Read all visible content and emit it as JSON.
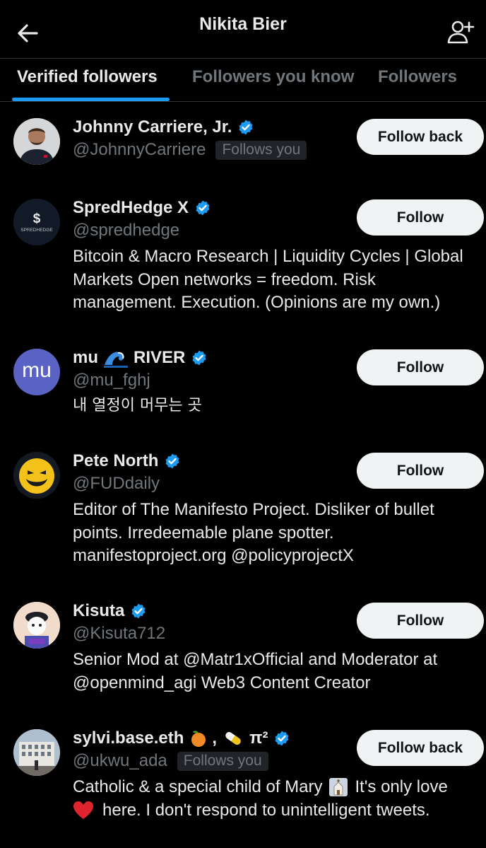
{
  "header": {
    "title": "Nikita Bier"
  },
  "tabs": [
    {
      "label": "Verified followers"
    },
    {
      "label": "Followers you know"
    },
    {
      "label": "Followers"
    }
  ],
  "colors": {
    "accent": "#1d9bf0",
    "verified": "#1d9bf0",
    "button_bg": "#eff3f4"
  },
  "users": [
    {
      "name": "Johnny Carriere, Jr.",
      "handle": "@JohnnyCarriere",
      "follows_you": "Follows you",
      "button": "Follow back",
      "bio": []
    },
    {
      "name": "SpredHedge X",
      "handle": "@spredhedge",
      "follows_you": "",
      "button": "Follow",
      "avatar_text": "SPREDHEDGE",
      "bio": [
        "Bitcoin & Macro Research | Liquidity Cycles | Global",
        "Markets Open networks = freedom. Risk",
        "management. Execution. (Opinions are my own.)"
      ]
    },
    {
      "name": "mu",
      "name_suffix": "RIVER",
      "handle": "@mu_fghj",
      "follows_you": "",
      "button": "Follow",
      "avatar_text": "mu",
      "bio": [
        "내 열정이 머무는 곳"
      ]
    },
    {
      "name": "Pete North",
      "handle": "@FUDdaily",
      "follows_you": "",
      "button": "Follow",
      "bio": [
        "Editor of The Manifesto Project. Disliker of bullet",
        "points. Irredeemable plane spotter.",
        "manifestoproject.org @policyprojectX"
      ]
    },
    {
      "name": "Kisuta",
      "handle": "@Kisuta712",
      "follows_you": "",
      "button": "Follow",
      "bio": [
        "Senior Mod at @Matr1xOfficial and Moderator at",
        "@openmind_agi Web3 Content Creator"
      ]
    },
    {
      "name": "sylvi.base.eth",
      "name_suffix": "π²",
      "handle": "@ukwu_ada",
      "follows_you": "Follows you",
      "button": "Follow back",
      "bio": [
        "Catholic & a special child of Mary",
        "It's only love",
        "here. I don't respond to unintelligent tweets."
      ]
    }
  ]
}
